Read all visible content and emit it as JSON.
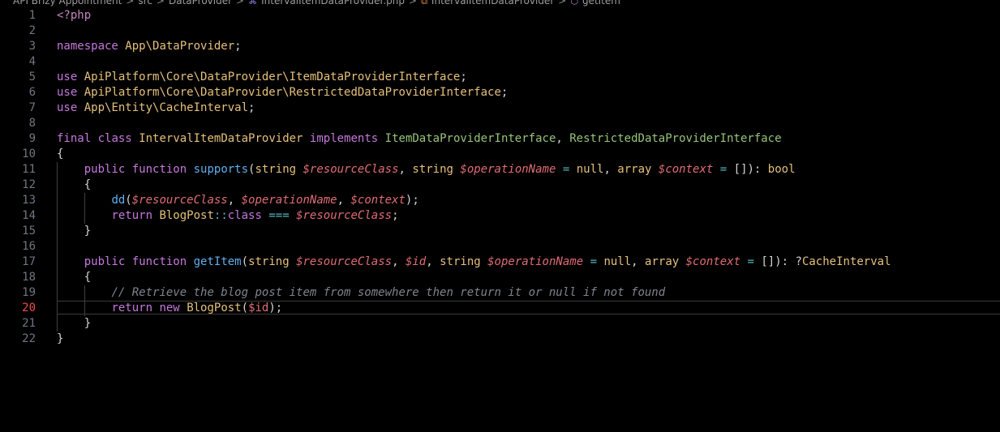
{
  "breadcrumb": {
    "items": [
      {
        "label": "API Brizy Appointment",
        "icon": null
      },
      {
        "label": "src",
        "icon": null
      },
      {
        "label": "DataProvider",
        "icon": null
      },
      {
        "label": "IntervalItemDataProvider.php",
        "icon": "php-file-icon"
      },
      {
        "label": "IntervalItemDataProvider",
        "icon": "class-icon"
      },
      {
        "label": "getItem",
        "icon": "method-icon"
      }
    ],
    "separator": ">"
  },
  "editor": {
    "active_line": 20,
    "colors": {
      "background": "#000000",
      "keyword": "#c678dd",
      "namespace": "#e5c07b",
      "function": "#61afef",
      "interface": "#98c379",
      "variable": "#e06c75",
      "operator": "#56b6c2",
      "comment": "#7f848e",
      "line_number": "#6e7681",
      "active_line_number": "#f14c4c"
    },
    "lines": [
      {
        "num": "1",
        "tokens": [
          {
            "t": "tag",
            "v": "<?php"
          }
        ]
      },
      {
        "num": "2",
        "tokens": []
      },
      {
        "num": "3",
        "tokens": [
          {
            "t": "kw",
            "v": "namespace"
          },
          {
            "t": "plain",
            "v": " "
          },
          {
            "t": "ns",
            "v": "App\\DataProvider"
          },
          {
            "t": "punc",
            "v": ";"
          }
        ]
      },
      {
        "num": "4",
        "tokens": []
      },
      {
        "num": "5",
        "tokens": [
          {
            "t": "kw",
            "v": "use"
          },
          {
            "t": "plain",
            "v": " "
          },
          {
            "t": "ns",
            "v": "ApiPlatform\\Core\\DataProvider\\ItemDataProviderInterface"
          },
          {
            "t": "punc",
            "v": ";"
          }
        ]
      },
      {
        "num": "6",
        "tokens": [
          {
            "t": "kw",
            "v": "use"
          },
          {
            "t": "plain",
            "v": " "
          },
          {
            "t": "ns",
            "v": "ApiPlatform\\Core\\DataProvider\\RestrictedDataProviderInterface"
          },
          {
            "t": "punc",
            "v": ";"
          }
        ]
      },
      {
        "num": "7",
        "tokens": [
          {
            "t": "kw",
            "v": "use"
          },
          {
            "t": "plain",
            "v": " "
          },
          {
            "t": "ns",
            "v": "App\\Entity\\CacheInterval"
          },
          {
            "t": "punc",
            "v": ";"
          }
        ]
      },
      {
        "num": "8",
        "tokens": []
      },
      {
        "num": "9",
        "tokens": [
          {
            "t": "kw",
            "v": "final"
          },
          {
            "t": "plain",
            "v": " "
          },
          {
            "t": "kw",
            "v": "class"
          },
          {
            "t": "plain",
            "v": " "
          },
          {
            "t": "type",
            "v": "IntervalItemDataProvider"
          },
          {
            "t": "plain",
            "v": " "
          },
          {
            "t": "kw",
            "v": "implements"
          },
          {
            "t": "plain",
            "v": " "
          },
          {
            "t": "iface",
            "v": "ItemDataProviderInterface"
          },
          {
            "t": "punc",
            "v": ", "
          },
          {
            "t": "iface",
            "v": "RestrictedDataProviderInterface"
          }
        ]
      },
      {
        "num": "10",
        "tokens": [
          {
            "t": "punc",
            "v": "{"
          }
        ]
      },
      {
        "num": "11",
        "tokens": [
          {
            "t": "plain",
            "v": "    "
          },
          {
            "t": "kw",
            "v": "public"
          },
          {
            "t": "plain",
            "v": " "
          },
          {
            "t": "kw",
            "v": "function"
          },
          {
            "t": "plain",
            "v": " "
          },
          {
            "t": "fn",
            "v": "supports"
          },
          {
            "t": "punc",
            "v": "("
          },
          {
            "t": "type",
            "v": "string"
          },
          {
            "t": "plain",
            "v": " "
          },
          {
            "t": "var",
            "v": "$resourceClass"
          },
          {
            "t": "punc",
            "v": ", "
          },
          {
            "t": "type",
            "v": "string"
          },
          {
            "t": "plain",
            "v": " "
          },
          {
            "t": "var",
            "v": "$operationName"
          },
          {
            "t": "plain",
            "v": " "
          },
          {
            "t": "op",
            "v": "="
          },
          {
            "t": "plain",
            "v": " "
          },
          {
            "t": "const",
            "v": "null"
          },
          {
            "t": "punc",
            "v": ", "
          },
          {
            "t": "type",
            "v": "array"
          },
          {
            "t": "plain",
            "v": " "
          },
          {
            "t": "var",
            "v": "$context"
          },
          {
            "t": "plain",
            "v": " "
          },
          {
            "t": "op",
            "v": "="
          },
          {
            "t": "plain",
            "v": " "
          },
          {
            "t": "punc",
            "v": "[]): "
          },
          {
            "t": "type",
            "v": "bool"
          }
        ]
      },
      {
        "num": "12",
        "tokens": [
          {
            "t": "plain",
            "v": "    "
          },
          {
            "t": "punc",
            "v": "{"
          }
        ]
      },
      {
        "num": "13",
        "tokens": [
          {
            "t": "plain",
            "v": "        "
          },
          {
            "t": "fn",
            "v": "dd"
          },
          {
            "t": "punc",
            "v": "("
          },
          {
            "t": "var",
            "v": "$resourceClass"
          },
          {
            "t": "punc",
            "v": ", "
          },
          {
            "t": "var",
            "v": "$operationName"
          },
          {
            "t": "punc",
            "v": ", "
          },
          {
            "t": "var",
            "v": "$context"
          },
          {
            "t": "punc",
            "v": ");"
          }
        ]
      },
      {
        "num": "14",
        "tokens": [
          {
            "t": "plain",
            "v": "        "
          },
          {
            "t": "kw",
            "v": "return"
          },
          {
            "t": "plain",
            "v": " "
          },
          {
            "t": "type",
            "v": "BlogPost"
          },
          {
            "t": "op",
            "v": "::"
          },
          {
            "t": "kw",
            "v": "class"
          },
          {
            "t": "plain",
            "v": " "
          },
          {
            "t": "op",
            "v": "==="
          },
          {
            "t": "plain",
            "v": " "
          },
          {
            "t": "var",
            "v": "$resourceClass"
          },
          {
            "t": "punc",
            "v": ";"
          }
        ]
      },
      {
        "num": "15",
        "tokens": [
          {
            "t": "plain",
            "v": "    "
          },
          {
            "t": "punc",
            "v": "}"
          }
        ]
      },
      {
        "num": "16",
        "tokens": []
      },
      {
        "num": "17",
        "tokens": [
          {
            "t": "plain",
            "v": "    "
          },
          {
            "t": "kw",
            "v": "public"
          },
          {
            "t": "plain",
            "v": " "
          },
          {
            "t": "kw",
            "v": "function"
          },
          {
            "t": "plain",
            "v": " "
          },
          {
            "t": "fn",
            "v": "getItem"
          },
          {
            "t": "punc",
            "v": "("
          },
          {
            "t": "type",
            "v": "string"
          },
          {
            "t": "plain",
            "v": " "
          },
          {
            "t": "var",
            "v": "$resourceClass"
          },
          {
            "t": "punc",
            "v": ", "
          },
          {
            "t": "var",
            "v": "$id"
          },
          {
            "t": "punc",
            "v": ", "
          },
          {
            "t": "type",
            "v": "string"
          },
          {
            "t": "plain",
            "v": " "
          },
          {
            "t": "var",
            "v": "$operationName"
          },
          {
            "t": "plain",
            "v": " "
          },
          {
            "t": "op",
            "v": "="
          },
          {
            "t": "plain",
            "v": " "
          },
          {
            "t": "const",
            "v": "null"
          },
          {
            "t": "punc",
            "v": ", "
          },
          {
            "t": "type",
            "v": "array"
          },
          {
            "t": "plain",
            "v": " "
          },
          {
            "t": "var",
            "v": "$context"
          },
          {
            "t": "plain",
            "v": " "
          },
          {
            "t": "op",
            "v": "="
          },
          {
            "t": "plain",
            "v": " "
          },
          {
            "t": "punc",
            "v": "[]): ?"
          },
          {
            "t": "type",
            "v": "CacheInterval"
          }
        ]
      },
      {
        "num": "18",
        "tokens": [
          {
            "t": "plain",
            "v": "    "
          },
          {
            "t": "punc",
            "v": "{"
          }
        ]
      },
      {
        "num": "19",
        "tokens": [
          {
            "t": "plain",
            "v": "        "
          },
          {
            "t": "comment",
            "v": "// Retrieve the blog post item from somewhere then return it or null if not found"
          }
        ]
      },
      {
        "num": "20",
        "tokens": [
          {
            "t": "plain",
            "v": "        "
          },
          {
            "t": "kw",
            "v": "return"
          },
          {
            "t": "plain",
            "v": " "
          },
          {
            "t": "kw",
            "v": "new"
          },
          {
            "t": "plain",
            "v": " "
          },
          {
            "t": "type",
            "v": "BlogPost"
          },
          {
            "t": "punc",
            "v": "("
          },
          {
            "t": "varplain",
            "v": "$id"
          },
          {
            "t": "punc",
            "v": ");"
          }
        ]
      },
      {
        "num": "21",
        "tokens": [
          {
            "t": "plain",
            "v": "    "
          },
          {
            "t": "punc",
            "v": "}"
          }
        ]
      },
      {
        "num": "22",
        "tokens": [
          {
            "t": "punc",
            "v": "}"
          }
        ]
      }
    ]
  }
}
